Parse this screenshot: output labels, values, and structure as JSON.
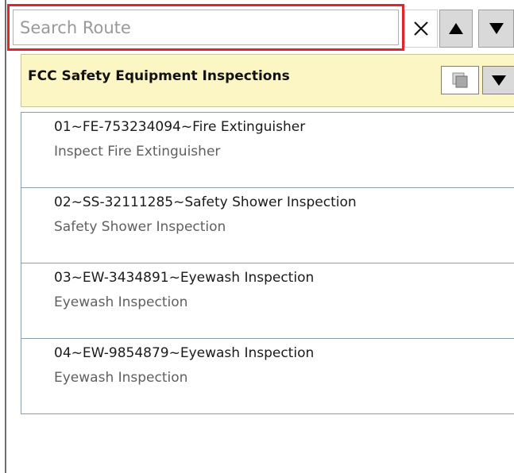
{
  "search": {
    "placeholder": "Search Route",
    "value": ""
  },
  "toolbar": {
    "clear_icon": "close-icon",
    "up_icon": "triangle-up-icon",
    "down_icon": "triangle-down-icon"
  },
  "route": {
    "title": "FCC Safety Equipment Inspections",
    "copy_icon": "copy-stack-icon",
    "menu_icon": "triangle-down-icon"
  },
  "items": [
    {
      "title": "01~FE-753234094~Fire Extinguisher",
      "subtitle": "Inspect Fire Extinguisher"
    },
    {
      "title": "02~SS-32111285~Safety Shower Inspection",
      "subtitle": "Safety Shower Inspection"
    },
    {
      "title": "03~EW-3434891~Eyewash Inspection",
      "subtitle": "Eyewash Inspection"
    },
    {
      "title": "04~EW-9854879~Eyewash Inspection",
      "subtitle": "Eyewash Inspection"
    }
  ],
  "colors": {
    "highlight": "#e0262d",
    "header_bg": "#fbf6c3",
    "item_border": "#8a9fac"
  }
}
